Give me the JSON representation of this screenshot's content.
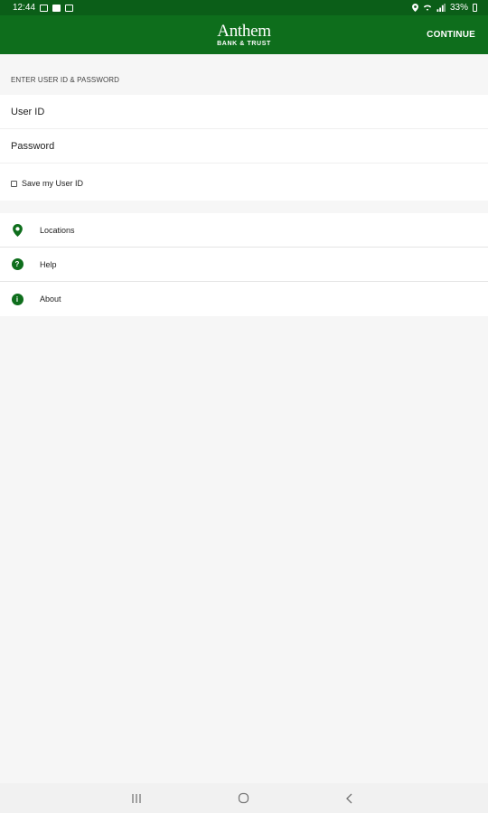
{
  "status_bar": {
    "time": "12:44",
    "battery": "33%",
    "left_icons": [
      "image-icon",
      "teams-icon",
      "chat-icon"
    ],
    "right_icons": [
      "location-icon",
      "wifi-icon",
      "signal-icon",
      "battery-icon"
    ]
  },
  "header": {
    "logo_main": "Anthem",
    "logo_sub": "BANK & TRUST",
    "continue_label": "CONTINUE",
    "bg_color": "#0e6e1c"
  },
  "login": {
    "section_label": "ENTER USER ID & PASSWORD",
    "user_id_placeholder": "User ID",
    "password_placeholder": "Password",
    "save_label": "Save my User ID"
  },
  "menu": {
    "items": [
      {
        "label": "Locations",
        "icon": "location-pin-icon"
      },
      {
        "label": "Help",
        "icon": "help-icon",
        "glyph": "?"
      },
      {
        "label": "About",
        "icon": "info-icon",
        "glyph": "i"
      }
    ]
  },
  "nav": {
    "buttons": [
      "recent-apps-icon",
      "home-icon",
      "back-icon"
    ]
  }
}
